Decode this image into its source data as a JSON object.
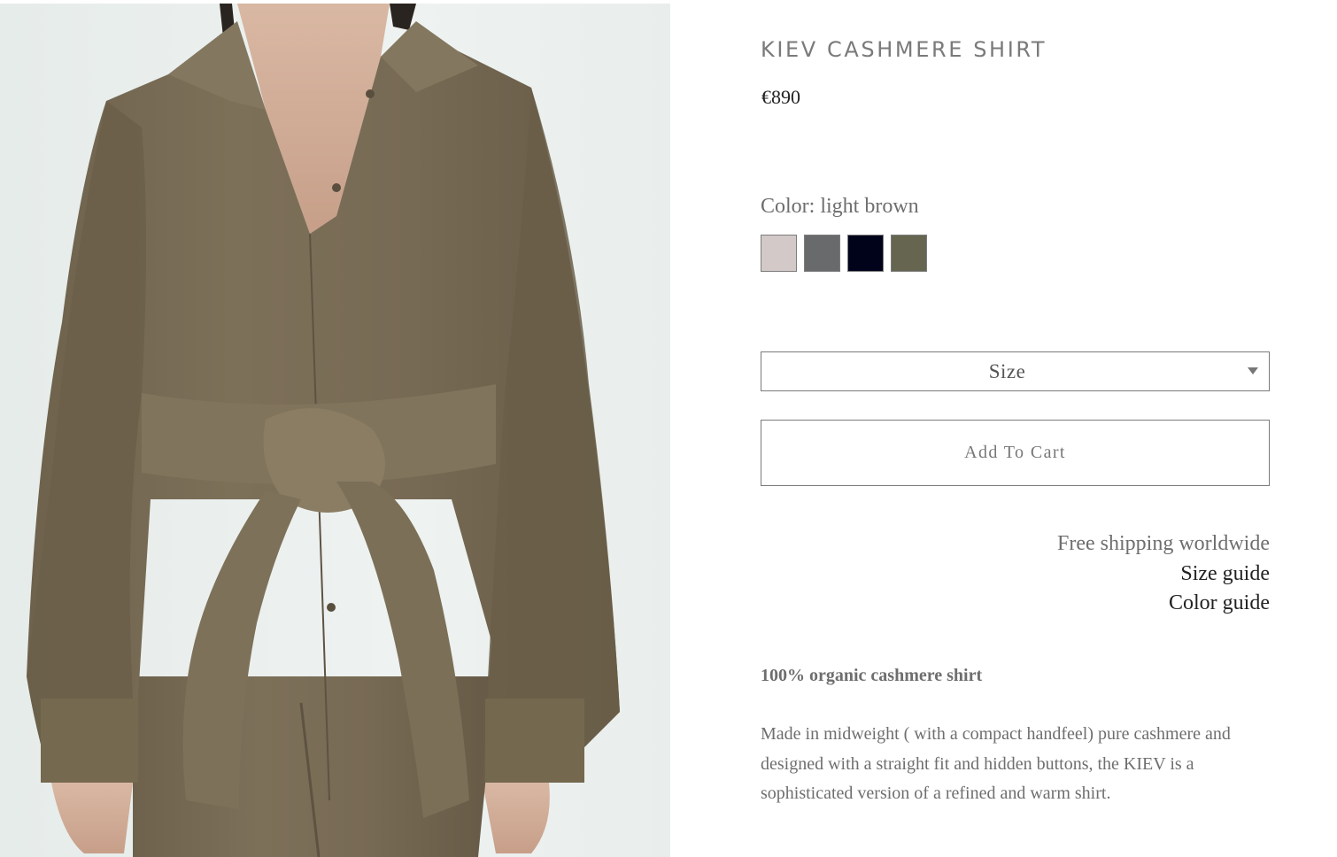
{
  "product": {
    "title": "KIEV CASHMERE SHIRT",
    "price": "€890",
    "color_label": "Color: light brown",
    "swatches": [
      {
        "name": "light pink",
        "hex": "#d3c9c9"
      },
      {
        "name": "grey",
        "hex": "#696a6b"
      },
      {
        "name": "navy",
        "hex": "#01031a"
      },
      {
        "name": "light brown",
        "hex": "#666550"
      }
    ],
    "size_select": {
      "label": "Size"
    },
    "add_to_cart_label": "Add To Cart"
  },
  "links": {
    "shipping": "Free shipping worldwide",
    "size_guide": "Size guide",
    "color_guide": "Color guide"
  },
  "description": {
    "heading": "100% organic cashmere shirt",
    "body": "Made in midweight  ( with a compact handfeel) pure cashmere and designed with a straight fit and hidden buttons, the KIEV is a sophisticated version of a refined and warm shirt."
  },
  "colors": {
    "fabric": "#7a6d57",
    "background": "#eaefed"
  }
}
